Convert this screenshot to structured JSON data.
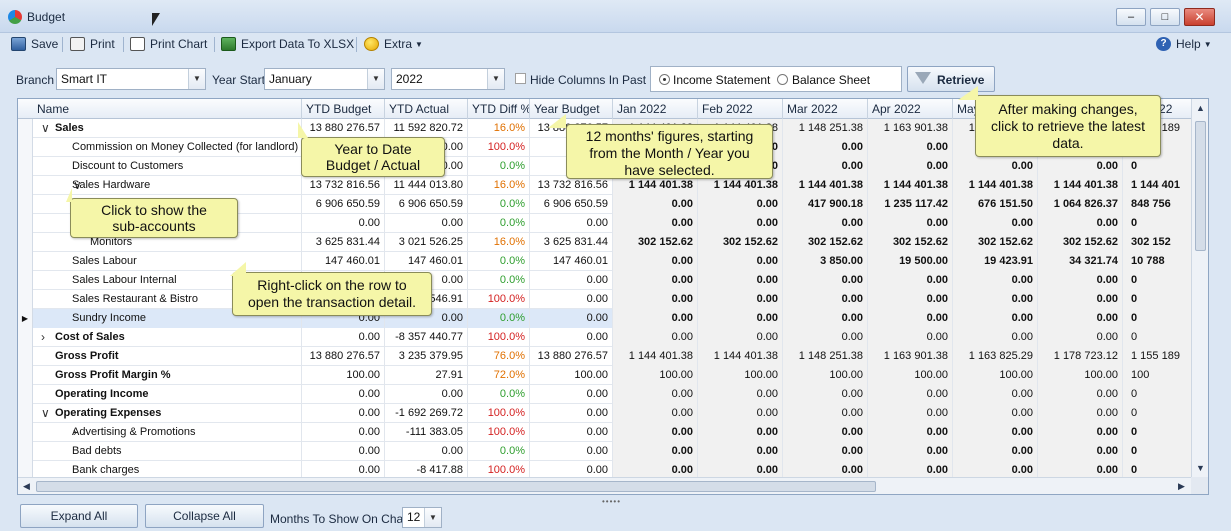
{
  "window": {
    "title": "Budget"
  },
  "toolbar": {
    "save": "Save",
    "print": "Print",
    "print_chart": "Print Chart",
    "export": "Export Data To XLSX",
    "extra": "Extra",
    "help": "Help"
  },
  "filters": {
    "branch_label": "Branch",
    "branch_value": "Smart IT",
    "year_start_label": "Year Start",
    "month_value": "January",
    "year_value": "2022",
    "hide_columns_label": "Hide Columns In Past",
    "income_statement": "Income Statement",
    "balance_sheet": "Balance Sheet",
    "retrieve": "Retrieve"
  },
  "grid": {
    "columns": [
      "Name",
      "YTD Budget",
      "YTD Actual",
      "YTD Diff %",
      "Year Budget",
      "Jan 2022",
      "Feb 2022",
      "Mar 2022",
      "Apr 2022",
      "May 2022",
      "Jun 2022",
      "Jul 2022"
    ],
    "rows": [
      {
        "name": "Sales",
        "level": 0,
        "exp": "v",
        "bold": true,
        "mbold": false,
        "vals": [
          "13 880 276.57",
          "11 592 820.72",
          "16.0%",
          "13 880 276.57",
          "1 144 401.38",
          "1 144 401.38",
          "1 148 251.38",
          "1 163 901.38",
          "1 163 825.29",
          "1 178 723.12",
          "1 155 189"
        ],
        "diff": "pos"
      },
      {
        "name": "Commission on Money Collected (for landlord)",
        "level": 2,
        "exp": "",
        "bold": false,
        "mbold": true,
        "vals": [
          "0.00",
          "0.00",
          "100.0%",
          "0.00",
          "0.00",
          "0.00",
          "0.00",
          "0.00",
          "0.00",
          "0.00",
          "0"
        ],
        "diff": "neg"
      },
      {
        "name": "Discount to Customers",
        "level": 2,
        "exp": "",
        "bold": false,
        "mbold": true,
        "vals": [
          "0.00",
          "0.00",
          "0.0%",
          "0.00",
          "0.00",
          "0.00",
          "0.00",
          "0.00",
          "0.00",
          "0.00",
          "0"
        ],
        "diff": "zero"
      },
      {
        "name": "Sales Hardware",
        "level": 2,
        "exp": "v",
        "bold": false,
        "mbold": true,
        "vals": [
          "13 732 816.56",
          "11 444 013.80",
          "16.0%",
          "13 732 816.56",
          "1 144 401.38",
          "1 144 401.38",
          "1 144 401.38",
          "1 144 401.38",
          "1 144 401.38",
          "1 144 401.38",
          "1 144 401"
        ],
        "diff": "pos"
      },
      {
        "name": "",
        "level": 3,
        "exp": "",
        "bold": false,
        "mbold": true,
        "vals": [
          "6 906 650.59",
          "6 906 650.59",
          "0.0%",
          "6 906 650.59",
          "0.00",
          "0.00",
          "417 900.18",
          "1 235 117.42",
          "676 151.50",
          "1 064 826.37",
          "848 756"
        ],
        "diff": "zero"
      },
      {
        "name": "",
        "level": 3,
        "exp": "",
        "bold": false,
        "mbold": true,
        "vals": [
          "0.00",
          "0.00",
          "0.0%",
          "0.00",
          "0.00",
          "0.00",
          "0.00",
          "0.00",
          "0.00",
          "0.00",
          "0"
        ],
        "diff": "zero"
      },
      {
        "name": "Monitors",
        "level": 3,
        "exp": "",
        "bold": false,
        "mbold": true,
        "vals": [
          "3 625 831.44",
          "3 021 526.25",
          "16.0%",
          "3 625 831.44",
          "302 152.62",
          "302 152.62",
          "302 152.62",
          "302 152.62",
          "302 152.62",
          "302 152.62",
          "302 152"
        ],
        "diff": "pos"
      },
      {
        "name": "Sales Labour",
        "level": 2,
        "exp": "",
        "bold": false,
        "mbold": true,
        "vals": [
          "147 460.01",
          "147 460.01",
          "0.0%",
          "147 460.01",
          "0.00",
          "0.00",
          "3 850.00",
          "19 500.00",
          "19 423.91",
          "34 321.74",
          "10 788"
        ],
        "diff": "zero"
      },
      {
        "name": "Sales Labour Internal",
        "level": 2,
        "exp": "",
        "bold": false,
        "mbold": true,
        "vals": [
          "0.00",
          "0.00",
          "0.0%",
          "0.00",
          "0.00",
          "0.00",
          "0.00",
          "0.00",
          "0.00",
          "0.00",
          "0"
        ],
        "diff": "zero"
      },
      {
        "name": "Sales Restaurant & Bistro",
        "level": 2,
        "exp": "",
        "bold": false,
        "mbold": true,
        "vals": [
          "0.00",
          "546.91",
          "100.0%",
          "0.00",
          "0.00",
          "0.00",
          "0.00",
          "0.00",
          "0.00",
          "0.00",
          "0"
        ],
        "diff": "neg"
      },
      {
        "name": "Sundry  Income",
        "level": 2,
        "exp": "",
        "bold": false,
        "mbold": true,
        "sel": true,
        "vals": [
          "0.00",
          "0.00",
          "0.0%",
          "0.00",
          "0.00",
          "0.00",
          "0.00",
          "0.00",
          "0.00",
          "0.00",
          "0"
        ],
        "diff": "zero"
      },
      {
        "name": "Cost of Sales",
        "level": 0,
        "exp": ">",
        "bold": true,
        "mbold": false,
        "vals": [
          "0.00",
          "-8 357 440.77",
          "100.0%",
          "0.00",
          "0.00",
          "0.00",
          "0.00",
          "0.00",
          "0.00",
          "0.00",
          "0"
        ],
        "diff": "neg"
      },
      {
        "name": "Gross Profit",
        "level": 1,
        "exp": "",
        "bold": true,
        "mbold": false,
        "vals": [
          "13 880 276.57",
          "3 235 379.95",
          "76.0%",
          "13 880 276.57",
          "1 144 401.38",
          "1 144 401.38",
          "1 148 251.38",
          "1 163 901.38",
          "1 163 825.29",
          "1 178 723.12",
          "1 155 189"
        ],
        "diff": "pos"
      },
      {
        "name": "Gross Profit Margin %",
        "level": 1,
        "exp": "",
        "bold": true,
        "mbold": false,
        "vals": [
          "100.00",
          "27.91",
          "72.0%",
          "100.00",
          "100.00",
          "100.00",
          "100.00",
          "100.00",
          "100.00",
          "100.00",
          "100"
        ],
        "diff": "pos"
      },
      {
        "name": "Operating Income",
        "level": 1,
        "exp": "",
        "bold": true,
        "mbold": false,
        "vals": [
          "0.00",
          "0.00",
          "0.0%",
          "0.00",
          "0.00",
          "0.00",
          "0.00",
          "0.00",
          "0.00",
          "0.00",
          "0"
        ],
        "diff": "zero"
      },
      {
        "name": "Operating Expenses",
        "level": 0,
        "exp": "v",
        "bold": true,
        "mbold": false,
        "vals": [
          "0.00",
          "-1 692 269.72",
          "100.0%",
          "0.00",
          "0.00",
          "0.00",
          "0.00",
          "0.00",
          "0.00",
          "0.00",
          "0"
        ],
        "diff": "neg"
      },
      {
        "name": "Advertising & Promotions",
        "level": 2,
        "exp": ">",
        "bold": false,
        "mbold": true,
        "vals": [
          "0.00",
          "-111 383.05",
          "100.0%",
          "0.00",
          "0.00",
          "0.00",
          "0.00",
          "0.00",
          "0.00",
          "0.00",
          "0"
        ],
        "diff": "neg"
      },
      {
        "name": "Bad debts",
        "level": 2,
        "exp": "",
        "bold": false,
        "mbold": true,
        "vals": [
          "0.00",
          "0.00",
          "0.0%",
          "0.00",
          "0.00",
          "0.00",
          "0.00",
          "0.00",
          "0.00",
          "0.00",
          "0"
        ],
        "diff": "zero"
      },
      {
        "name": "Bank charges",
        "level": 2,
        "exp": "",
        "bold": false,
        "mbold": true,
        "vals": [
          "0.00",
          "-8 417.88",
          "100.0%",
          "0.00",
          "0.00",
          "0.00",
          "0.00",
          "0.00",
          "0.00",
          "0.00",
          "0"
        ],
        "diff": "neg"
      }
    ]
  },
  "callouts": {
    "ytd": "Year to Date\nBudget / Actual",
    "months": "12 months' figures, starting\nfrom the Month / Year you\nhave selected.",
    "retrieve": "After making changes,\nclick to retrieve the latest\ndata.",
    "subaccounts": "Click to show the\nsub-accounts",
    "rightclick": "Right-click on the row to\nopen the transaction detail."
  },
  "bottom": {
    "expand_all": "Expand All",
    "collapse_all": "Collapse All",
    "months_label": "Months To Show On Chart",
    "months_value": "12"
  },
  "colors": {
    "positive_diff": "#e07000",
    "negative_diff": "#d42222",
    "zero_diff": "#2e9e2e"
  }
}
